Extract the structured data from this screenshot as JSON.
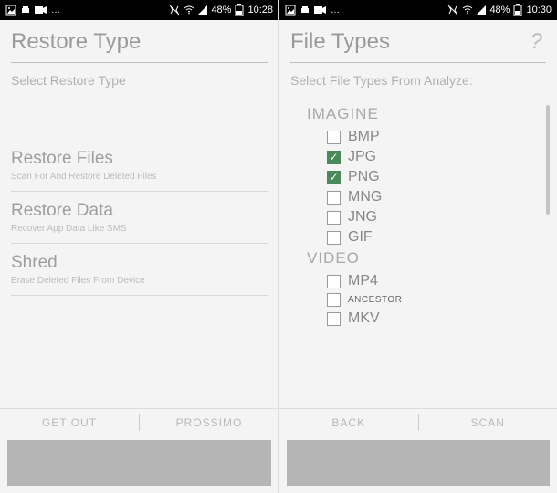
{
  "left": {
    "status": {
      "battery": "48%",
      "time": "10:28"
    },
    "header": {
      "title": "Restore Type"
    },
    "subtitle": "Select Restore Type",
    "options": [
      {
        "title": "Restore Files",
        "desc": "Scan For And Restore Deleted Files"
      },
      {
        "title": "Restore Data",
        "desc": "Recover App Data Like SMS"
      },
      {
        "title": "Shred",
        "desc": "Erase Deleted Files From Device"
      }
    ],
    "buttons": {
      "left": "GET OUT",
      "right": "PROSSIMO"
    }
  },
  "right": {
    "status": {
      "battery": "48%",
      "time": "10:30"
    },
    "header": {
      "title": "File Types",
      "help": "?"
    },
    "subtitle": "Select File Types From Analyze:",
    "groups": [
      {
        "name": "IMAGINE",
        "items": [
          {
            "label": "BMP",
            "checked": false
          },
          {
            "label": "JPG",
            "checked": true
          },
          {
            "label": "PNG",
            "checked": true
          },
          {
            "label": "MNG",
            "checked": false
          },
          {
            "label": "JNG",
            "checked": false
          },
          {
            "label": "GIF",
            "checked": false
          }
        ]
      },
      {
        "name": "VIDEO",
        "items": [
          {
            "label": "MP4",
            "checked": false
          },
          {
            "label": "ANCESTOR",
            "checked": false,
            "small": true
          },
          {
            "label": "MKV",
            "checked": false
          }
        ]
      }
    ],
    "buttons": {
      "left": "BACK",
      "right": "SCAN"
    }
  }
}
